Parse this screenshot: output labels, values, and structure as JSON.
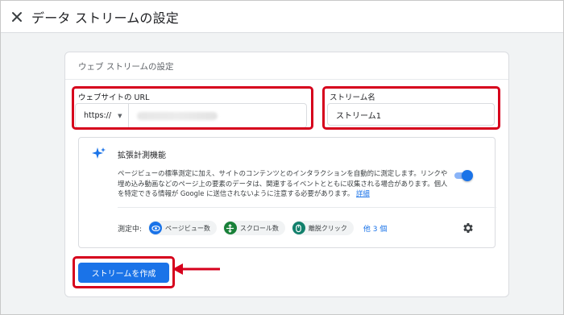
{
  "header": {
    "title": "データ ストリームの設定",
    "close_icon": "close-icon"
  },
  "card": {
    "title": "ウェブ ストリームの設定",
    "url_label": "ウェブサイトの URL",
    "protocol": "https://",
    "name_label": "ストリーム名",
    "name_value": "ストリーム1"
  },
  "enhanced": {
    "title": "拡張計測機能",
    "description": "ページビューの標準測定に加え、サイトのコンテンツとのインタラクションを自動的に測定します。リンクや埋め込み動画などのページ上の要素のデータは、関連するイベントとともに収集される場合があります。個人を特定できる情報が Google に送信されないように注意する必要があります。",
    "details_link": "詳細",
    "toggle_on": true,
    "measuring_label": "測定中:",
    "chips": [
      {
        "label": "ページビュー数",
        "icon": "eye-icon",
        "color": "#1a73e8"
      },
      {
        "label": "スクロール数",
        "icon": "crosshair-icon",
        "color": "#188038"
      },
      {
        "label": "離脱クリック",
        "icon": "mouse-icon",
        "color": "#12806c"
      }
    ],
    "more_link": "他 3 個"
  },
  "actions": {
    "create_button": "ストリームを作成"
  },
  "colors": {
    "accent": "#1a73e8",
    "highlight": "#d6001c"
  }
}
